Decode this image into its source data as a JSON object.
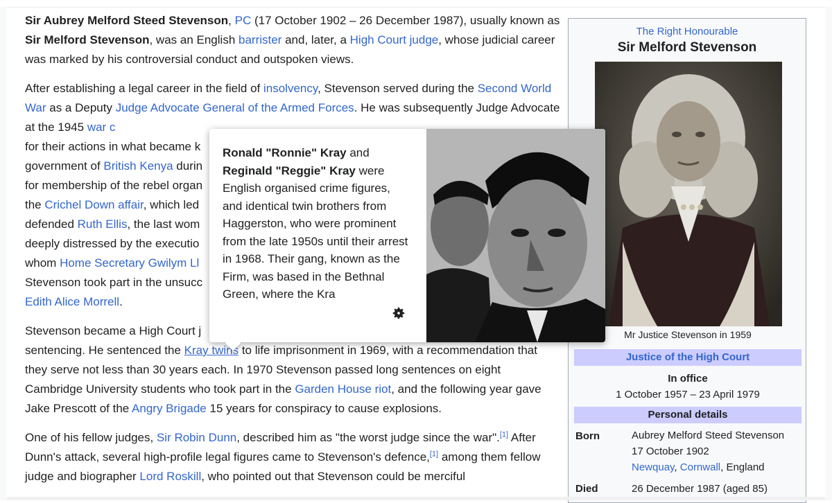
{
  "article": {
    "p1": {
      "name_bold": "Sir Aubrey Melford Steed Stevenson",
      "sep1": ", ",
      "pc_link": "PC",
      "t1": " (17 October 1902 – 26 December 1987), usually known as ",
      "known_bold": "Sir Melford Stevenson",
      "t2": ", was an English ",
      "barrister_link": "barrister",
      "t3": " and, later, a ",
      "hcj_link": "High Court judge",
      "t4": ", whose judicial career was marked by his controversial conduct and outspoken views."
    },
    "p2": {
      "t1": "After establishing a legal career in the field of ",
      "insolvency_link": "insolvency",
      "t2": ", Stevenson served during the ",
      "ww2_link": "Second World War",
      "t3": " as a Deputy ",
      "jag_link": "Judge Advocate General of the Armed Forces",
      "t4": ". He was subsequently Judge Advocate at the 1945 ",
      "war_link": "war c",
      "t5": " for their actions in what became k",
      "t6": " government of ",
      "kenya_link": "British Kenya",
      "t7": " durin",
      "t8": " for membership of the rebel organ",
      "t9": " the ",
      "crichel_link": "Crichel Down affair",
      "t10": ", which led",
      "t11": " defended ",
      "ellis_link": "Ruth Ellis",
      "t12": ", the last wom",
      "t13": " deeply distressed by the executio",
      "t14": " whom ",
      "homesec_link": "Home Secretary Gwilym Ll",
      "t15": " Stevenson took part in the unsucc",
      "morrell_link": "Edith Alice Morrell",
      "t16": "."
    },
    "p3": {
      "t1": "Stevenson became a High Court j",
      "t2": " sentencing. He sentenced the ",
      "kray_link": "Kray twins",
      "t3": " to life imprisonment in 1969, with a recommendation that they serve not less than 30 years each. In 1970 Stevenson passed long sentences on eight Cambridge University students who took part in the ",
      "garden_link": "Garden House riot",
      "t4": ", and the following year gave Jake Prescott of the ",
      "angry_link": "Angry Brigade",
      "t5": " 15 years for conspiracy to cause explosions."
    },
    "p4": {
      "t1": "One of his fellow judges, ",
      "dunn_link": "Sir Robin Dunn",
      "t2": ", described him as \"the worst judge since the war\".",
      "ref1": "[1]",
      "t3": " After Dunn's attack, several high-profile legal figures came to Stevenson's defence,",
      "ref2": "[1]",
      "t4": " among them fellow judge and biographer ",
      "roskill_link": "Lord Roskill",
      "t5": ", who pointed out that Stevenson could be merciful"
    }
  },
  "popup": {
    "ronald": "Ronald",
    "ronnie": "\"Ronnie\"",
    "kray1": "Kray",
    "and": " and ",
    "reginald": "Reginald",
    "reggie": "\"Reggie\"",
    "kray2": "Kray",
    "rest": " were English organised crime figures, and identical twin brothers from Haggerston, who were prominent from the late 1950s until their arrest in 1968. Their gang, known as the Firm, was based in the Bethnal Green, where the Kra",
    "gear_icon": "gear-icon"
  },
  "infobox": {
    "honorific": "The Right Honourable",
    "name": "Sir Melford Stevenson",
    "caption": "Mr Justice Stevenson in 1959",
    "office_header": "Justice of the High Court",
    "in_office": "In office",
    "term": "1 October 1957 – 23 April 1979",
    "personal_header": "Personal details",
    "born_label": "Born",
    "born_name": "Aubrey Melford Steed Stevenson",
    "born_date": "17 October 1902",
    "born_place_link1": "Newquay",
    "born_place_sep": ", ",
    "born_place_link2": "Cornwall",
    "born_place_rest": ", England",
    "died_label": "Died",
    "died_value": "26 December 1987 (aged 85)"
  }
}
